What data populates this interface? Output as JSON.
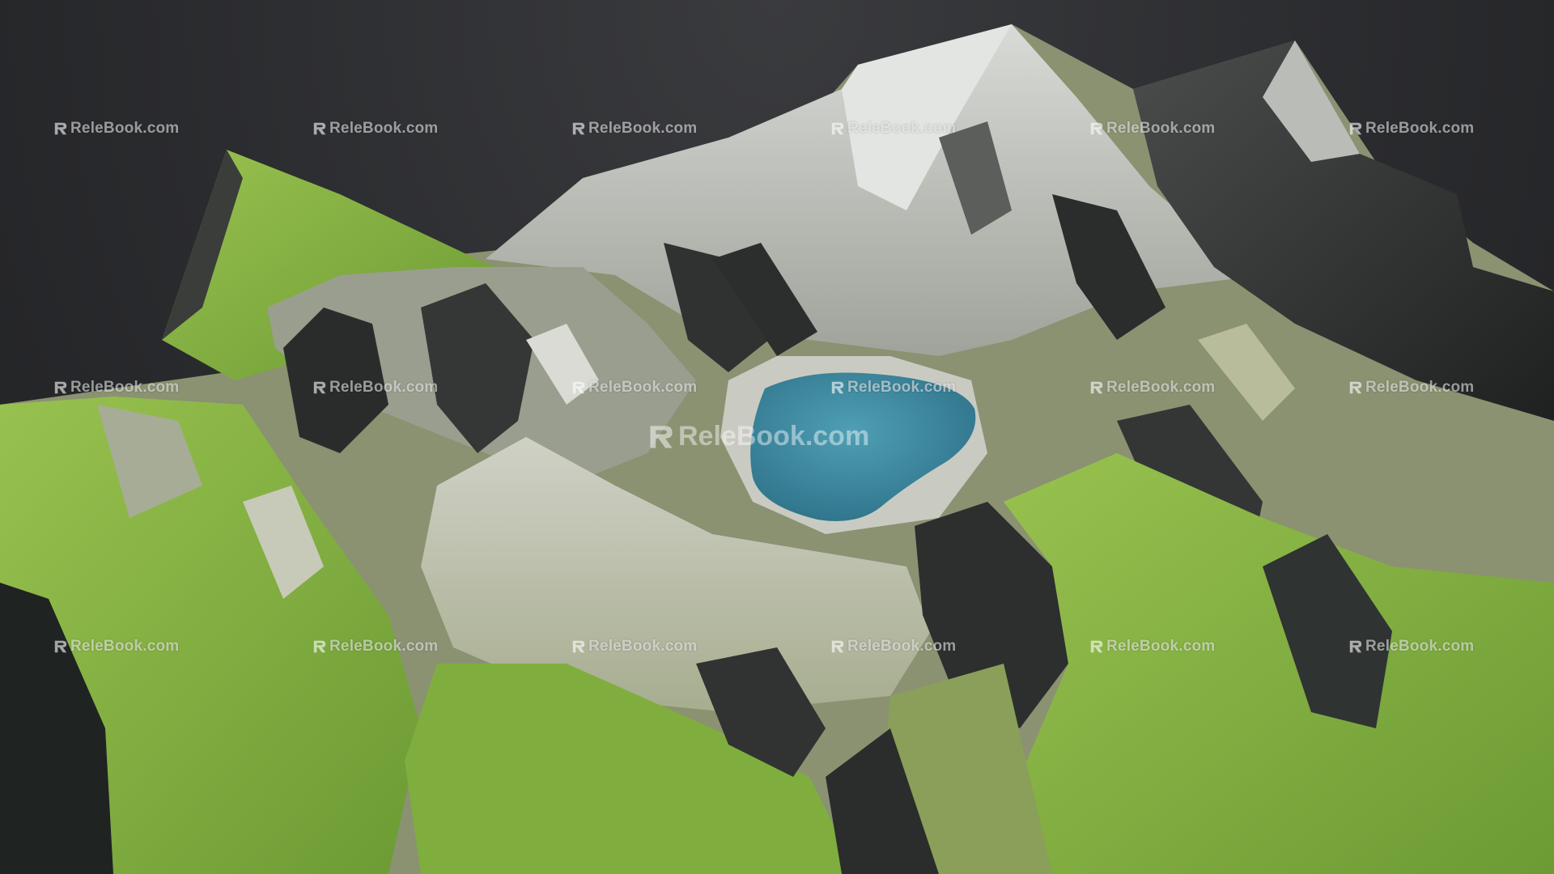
{
  "scene": {
    "description_colors": {
      "background": "#2b2c2f",
      "grass": "#7fae3e",
      "rock_light": "#c9cbc4",
      "rock_dark": "#2e3030",
      "lake": "#3f8fa6"
    }
  },
  "watermark": {
    "text": "ReleBook.com",
    "center_text": "ReleBook.com",
    "icon": "relebook-logo-icon"
  }
}
